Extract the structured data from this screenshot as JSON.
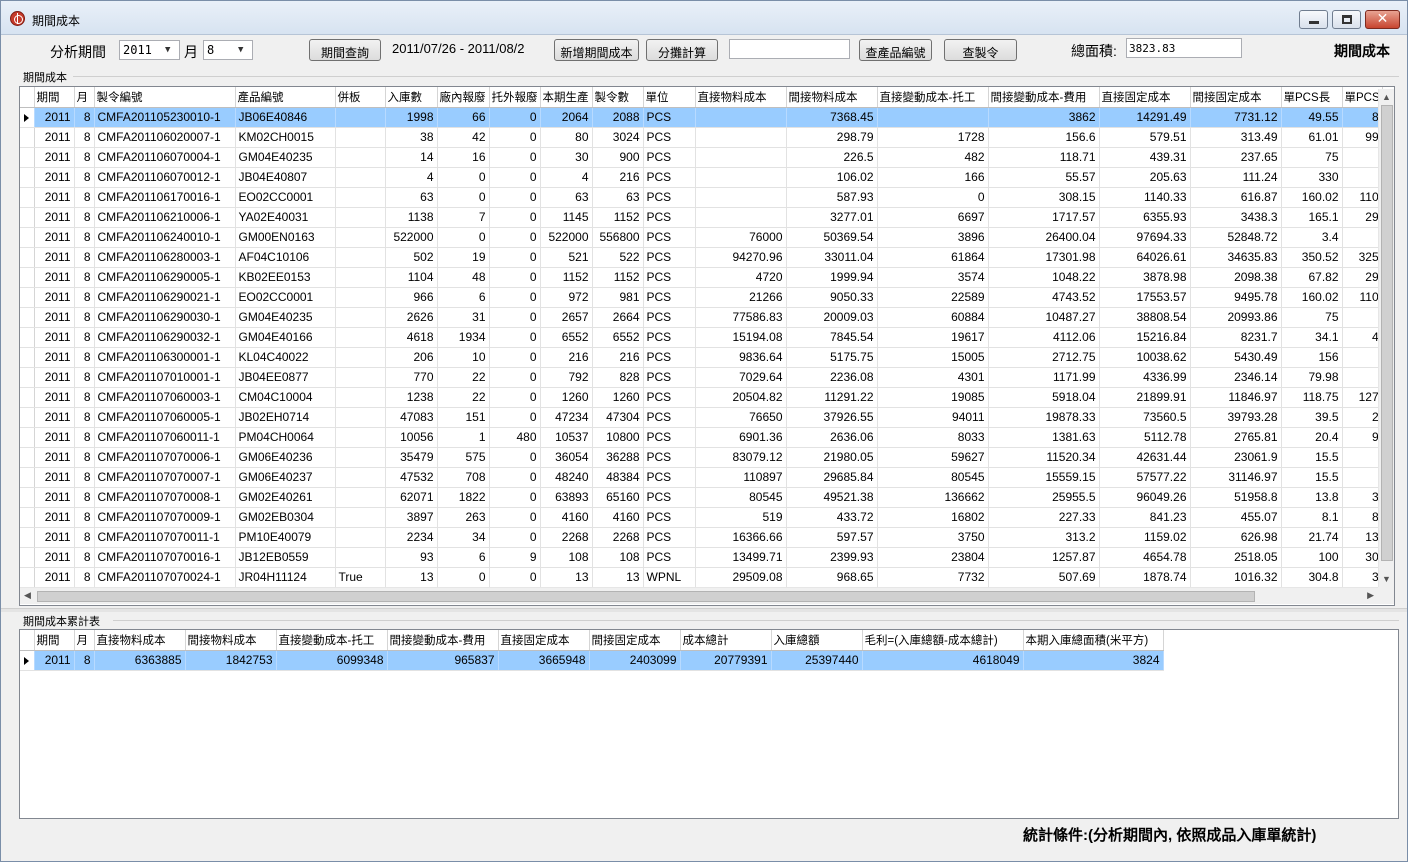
{
  "window": {
    "title": "期間成本"
  },
  "toolbar": {
    "period_label": "分析期間",
    "year_value": "2011",
    "month_label": "月",
    "month_value": "8",
    "query_button": "期間查詢",
    "date_range": "2011/07/26 - 2011/08/2",
    "add_button": "新增期間成本",
    "allocate_button": "分攤計算",
    "search_value": "",
    "product_button": "查產品編號",
    "order_button": "查製令",
    "area_label": "總面積:",
    "area_value": "3823.83",
    "corner_title": "期間成本"
  },
  "main_grid": {
    "group_label": "期間成本",
    "columns": [
      "期間",
      "月",
      "製令編號",
      "產品編號",
      "併板",
      "入庫數",
      "廠內報廢",
      "托外報廢",
      "本期生產",
      "製令數",
      "單位",
      "直接物料成本",
      "間接物料成本",
      "直接變動成本-托工",
      "間接變動成本-費用",
      "直接固定成本",
      "間接固定成本",
      "單PCS長",
      "單PCS"
    ],
    "rows": [
      [
        "2011",
        "8",
        "CMFA201105230010-1",
        "JB06E40846",
        "",
        "1998",
        "66",
        "0",
        "2064",
        "2088",
        "PCS",
        "",
        "7368.45",
        "",
        "3862",
        "14291.49",
        "7731.12",
        "49.55",
        "8"
      ],
      [
        "2011",
        "8",
        "CMFA201106020007-1",
        "KM02CH0015",
        "",
        "38",
        "42",
        "0",
        "80",
        "3024",
        "PCS",
        "",
        "298.79",
        "1728",
        "156.6",
        "579.51",
        "313.49",
        "61.01",
        "99"
      ],
      [
        "2011",
        "8",
        "CMFA201106070004-1",
        "GM04E40235",
        "",
        "14",
        "16",
        "0",
        "30",
        "900",
        "PCS",
        "",
        "226.5",
        "482",
        "118.71",
        "439.31",
        "237.65",
        "75",
        ""
      ],
      [
        "2011",
        "8",
        "CMFA201106070012-1",
        "JB04E40807",
        "",
        "4",
        "0",
        "0",
        "4",
        "216",
        "PCS",
        "",
        "106.02",
        "166",
        "55.57",
        "205.63",
        "111.24",
        "330",
        ""
      ],
      [
        "2011",
        "8",
        "CMFA201106170016-1",
        "EO02CC0001",
        "",
        "63",
        "0",
        "0",
        "63",
        "63",
        "PCS",
        "",
        "587.93",
        "0",
        "308.15",
        "1140.33",
        "616.87",
        "160.02",
        "110"
      ],
      [
        "2011",
        "8",
        "CMFA201106210006-1",
        "YA02E40031",
        "",
        "1138",
        "7",
        "0",
        "1145",
        "1152",
        "PCS",
        "",
        "3277.01",
        "6697",
        "1717.57",
        "6355.93",
        "3438.3",
        "165.1",
        "29"
      ],
      [
        "2011",
        "8",
        "CMFA201106240010-1",
        "GM00EN0163",
        "",
        "522000",
        "0",
        "0",
        "522000",
        "556800",
        "PCS",
        "76000",
        "50369.54",
        "3896",
        "26400.04",
        "97694.33",
        "52848.72",
        "3.4",
        ""
      ],
      [
        "2011",
        "8",
        "CMFA201106280003-1",
        "AF04C10106",
        "",
        "502",
        "19",
        "0",
        "521",
        "522",
        "PCS",
        "94270.96",
        "33011.04",
        "61864",
        "17301.98",
        "64026.61",
        "34635.83",
        "350.52",
        "325"
      ],
      [
        "2011",
        "8",
        "CMFA201106290005-1",
        "KB02EE0153",
        "",
        "1104",
        "48",
        "0",
        "1152",
        "1152",
        "PCS",
        "4720",
        "1999.94",
        "3574",
        "1048.22",
        "3878.98",
        "2098.38",
        "67.82",
        "29"
      ],
      [
        "2011",
        "8",
        "CMFA201106290021-1",
        "EO02CC0001",
        "",
        "966",
        "6",
        "0",
        "972",
        "981",
        "PCS",
        "21266",
        "9050.33",
        "22589",
        "4743.52",
        "17553.57",
        "9495.78",
        "160.02",
        "110"
      ],
      [
        "2011",
        "8",
        "CMFA201106290030-1",
        "GM04E40235",
        "",
        "2626",
        "31",
        "0",
        "2657",
        "2664",
        "PCS",
        "77586.83",
        "20009.03",
        "60884",
        "10487.27",
        "38808.54",
        "20993.86",
        "75",
        ""
      ],
      [
        "2011",
        "8",
        "CMFA201106290032-1",
        "GM04E40166",
        "",
        "4618",
        "1934",
        "0",
        "6552",
        "6552",
        "PCS",
        "15194.08",
        "7845.54",
        "19617",
        "4112.06",
        "15216.84",
        "8231.7",
        "34.1",
        "4"
      ],
      [
        "2011",
        "8",
        "CMFA201106300001-1",
        "KL04C40022",
        "",
        "206",
        "10",
        "0",
        "216",
        "216",
        "PCS",
        "9836.64",
        "5175.75",
        "15005",
        "2712.75",
        "10038.62",
        "5430.49",
        "156",
        ""
      ],
      [
        "2011",
        "8",
        "CMFA201107010001-1",
        "JB04EE0877",
        "",
        "770",
        "22",
        "0",
        "792",
        "828",
        "PCS",
        "7029.64",
        "2236.08",
        "4301",
        "1171.99",
        "4336.99",
        "2346.14",
        "79.98",
        ""
      ],
      [
        "2011",
        "8",
        "CMFA201107060003-1",
        "CM04C10004",
        "",
        "1238",
        "22",
        "0",
        "1260",
        "1260",
        "PCS",
        "20504.82",
        "11291.22",
        "19085",
        "5918.04",
        "21899.91",
        "11846.97",
        "118.75",
        "127"
      ],
      [
        "2011",
        "8",
        "CMFA201107060005-1",
        "JB02EH0714",
        "",
        "47083",
        "151",
        "0",
        "47234",
        "47304",
        "PCS",
        "76650",
        "37926.55",
        "94011",
        "19878.33",
        "73560.5",
        "39793.28",
        "39.5",
        "2"
      ],
      [
        "2011",
        "8",
        "CMFA201107060011-1",
        "PM04CH0064",
        "",
        "10056",
        "1",
        "480",
        "10537",
        "10800",
        "PCS",
        "6901.36",
        "2636.06",
        "8033",
        "1381.63",
        "5112.78",
        "2765.81",
        "20.4",
        "9"
      ],
      [
        "2011",
        "8",
        "CMFA201107070006-1",
        "GM06E40236",
        "",
        "35479",
        "575",
        "0",
        "36054",
        "36288",
        "PCS",
        "83079.12",
        "21980.05",
        "59627",
        "11520.34",
        "42631.44",
        "23061.9",
        "15.5",
        ""
      ],
      [
        "2011",
        "8",
        "CMFA201107070007-1",
        "GM06E40237",
        "",
        "47532",
        "708",
        "0",
        "48240",
        "48384",
        "PCS",
        "110897",
        "29685.84",
        "80545",
        "15559.15",
        "57577.22",
        "31146.97",
        "15.5",
        ""
      ],
      [
        "2011",
        "8",
        "CMFA201107070008-1",
        "GM02E40261",
        "",
        "62071",
        "1822",
        "0",
        "63893",
        "65160",
        "PCS",
        "80545",
        "49521.38",
        "136662",
        "25955.5",
        "96049.26",
        "51958.8",
        "13.8",
        "3"
      ],
      [
        "2011",
        "8",
        "CMFA201107070009-1",
        "GM02EB0304",
        "",
        "3897",
        "263",
        "0",
        "4160",
        "4160",
        "PCS",
        "519",
        "433.72",
        "16802",
        "227.33",
        "841.23",
        "455.07",
        "8.1",
        "8"
      ],
      [
        "2011",
        "8",
        "CMFA201107070011-1",
        "PM10E40079",
        "",
        "2234",
        "34",
        "0",
        "2268",
        "2268",
        "PCS",
        "16366.66",
        "597.57",
        "3750",
        "313.2",
        "1159.02",
        "626.98",
        "21.74",
        "13"
      ],
      [
        "2011",
        "8",
        "CMFA201107070016-1",
        "JB12EB0559",
        "",
        "93",
        "6",
        "9",
        "108",
        "108",
        "PCS",
        "13499.71",
        "2399.93",
        "23804",
        "1257.87",
        "4654.78",
        "2518.05",
        "100",
        "30"
      ],
      [
        "2011",
        "8",
        "CMFA201107070024-1",
        "JR04H11124",
        "True",
        "13",
        "0",
        "0",
        "13",
        "13",
        "WPNL",
        "29509.08",
        "968.65",
        "7732",
        "507.69",
        "1878.74",
        "1016.32",
        "304.8",
        "3"
      ]
    ]
  },
  "summary_grid": {
    "group_label": "期間成本累計表",
    "columns": [
      "期間",
      "月",
      "直接物料成本",
      "間接物料成本",
      "直接變動成本-托工",
      "間接變動成本-費用",
      "直接固定成本",
      "間接固定成本",
      "成本總計",
      "入庫總額",
      "毛利=(入庫總額-成本總計)",
      "本期入庫總面積(米平方)"
    ],
    "rows": [
      [
        "2011",
        "8",
        "6363885",
        "1842753",
        "6099348",
        "965837",
        "3665948",
        "2403099",
        "20779391",
        "25397440",
        "4618049",
        "3824"
      ]
    ]
  },
  "footer": {
    "text": "統計條件:(分析期間內, 依照成品入庫單統計)"
  }
}
